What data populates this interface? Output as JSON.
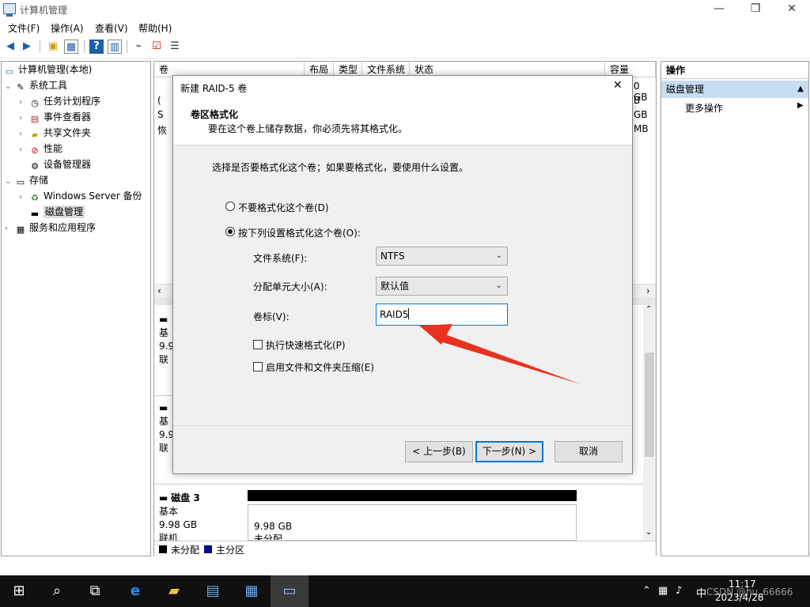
{
  "window": {
    "title": "计算机管理",
    "controls": {
      "minimize": "—",
      "maximize": "❐",
      "close": "✕"
    }
  },
  "menu": [
    "文件(F)",
    "操作(A)",
    "查看(V)",
    "帮助(H)"
  ],
  "tree": {
    "root": "计算机管理(本地)",
    "system_tools": "系统工具",
    "task_scheduler": "任务计划程序",
    "event_viewer": "事件查看器",
    "shared_folders": "共享文件夹",
    "performance": "性能",
    "device_manager": "设备管理器",
    "storage": "存储",
    "windows_backup": "Windows Server 备份",
    "disk_management": "磁盘管理",
    "services_apps": "服务和应用程序"
  },
  "volume_table": {
    "columns": [
      "卷",
      "布局",
      "类型",
      "文件系统",
      "状态",
      "容量"
    ],
    "capacities": [
      "0 GB",
      "B",
      "GB",
      "MB"
    ],
    "row_prefixes": [
      "",
      "(",
      "S",
      "恢"
    ]
  },
  "disks": [
    {
      "line1": "基",
      "line2": "9.9",
      "line3": "联"
    },
    {
      "line1": "基",
      "line2": "9.9",
      "line3": "联"
    }
  ],
  "disk3": {
    "name": "磁盘 3",
    "type": "基本",
    "size": "9.98 GB",
    "status": "联机",
    "part_size": "9.98 GB",
    "part_status": "未分配"
  },
  "legend": {
    "unallocated": "未分配",
    "primary": "主分区"
  },
  "actions": {
    "header": "操作",
    "section": "磁盘管理",
    "more": "更多操作"
  },
  "dialog": {
    "title": "新建 RAID-5 卷",
    "heading": "卷区格式化",
    "subheading": "要在这个卷上储存数据，你必须先将其格式化。",
    "prompt": "选择是否要格式化这个卷；如果要格式化，要使用什么设置。",
    "opt_no_format": "不要格式化这个卷(D)",
    "opt_format": "按下列设置格式化这个卷(O):",
    "fs_label": "文件系统(F):",
    "fs_value": "NTFS",
    "alloc_label": "分配单元大小(A):",
    "alloc_value": "默认值",
    "vol_label": "卷标(V):",
    "vol_value": "RAID5",
    "quick_format": "执行快速格式化(P)",
    "compress": "启用文件和文件夹压缩(E)",
    "back": "< 上一步(B)",
    "next": "下一步(N) >",
    "cancel": "取消"
  },
  "taskbar": {
    "ime": "中",
    "time": "11:17",
    "date": "2023/4/28",
    "watermark": "CSDN @hu_66666"
  },
  "colors": {
    "accent": "#0078d7",
    "selection": "#c7ddf2",
    "arrow": "#e8321e",
    "primary_partition": "#0a0a8c"
  }
}
